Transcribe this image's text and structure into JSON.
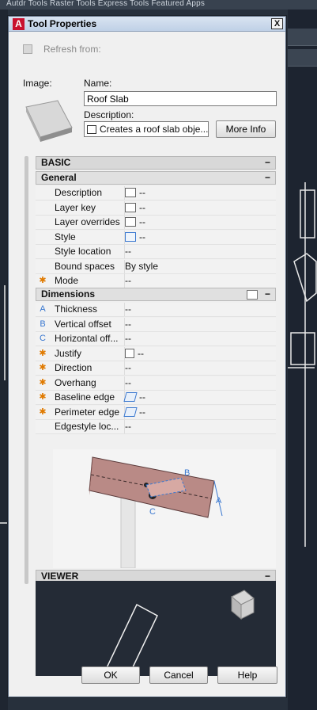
{
  "background": {
    "menu_text": "Autdr Tools    Raster Tools    Express Tools    Featured Apps"
  },
  "dialog": {
    "title": "Tool Properties",
    "close_label": "X",
    "refresh_label": "Refresh from:",
    "image_label": "Image:",
    "name_label": "Name:",
    "name_value": "Roof Slab",
    "description_label": "Description:",
    "description_value": "Creates a roof slab obje...",
    "more_info_label": "More Info"
  },
  "sections": {
    "basic": "BASIC",
    "general": "General",
    "dimensions": "Dimensions",
    "viewer": "VIEWER",
    "collapse_symbol": "−"
  },
  "general_rows": [
    {
      "key": "Description",
      "value": "--",
      "marker": "",
      "icon": "table-icon"
    },
    {
      "key": "Layer key",
      "value": "--",
      "marker": "",
      "icon": "table-icon"
    },
    {
      "key": "Layer overrides",
      "value": "--",
      "marker": "",
      "icon": "table-icon"
    },
    {
      "key": "Style",
      "value": "--",
      "marker": "",
      "icon": "style-icon"
    },
    {
      "key": "Style location",
      "value": "--",
      "marker": "",
      "icon": ""
    },
    {
      "key": "Bound spaces",
      "value": "By style",
      "marker": "",
      "icon": ""
    },
    {
      "key": "Mode",
      "value": "--",
      "marker": "✱",
      "icon": ""
    }
  ],
  "dimension_rows": [
    {
      "key": "Thickness",
      "value": "--",
      "marker": "A",
      "icon": ""
    },
    {
      "key": "Vertical offset",
      "value": "--",
      "marker": "B",
      "icon": ""
    },
    {
      "key": "Horizontal off...",
      "value": "--",
      "marker": "C",
      "icon": ""
    },
    {
      "key": "Justify",
      "value": "--",
      "marker": "✱",
      "icon": "checkbox-icon"
    },
    {
      "key": "Direction",
      "value": "--",
      "marker": "✱",
      "icon": ""
    },
    {
      "key": "Overhang",
      "value": "--",
      "marker": "✱",
      "icon": ""
    },
    {
      "key": "Baseline edge",
      "value": "--",
      "marker": "✱",
      "icon": "edge-icon"
    },
    {
      "key": "Perimeter edge",
      "value": "--",
      "marker": "✱",
      "icon": "edge-icon"
    },
    {
      "key": "Edgestyle loc...",
      "value": "--",
      "marker": "",
      "icon": ""
    }
  ],
  "diagram_labels": {
    "a": "A",
    "b": "B",
    "c": "C"
  },
  "buttons": {
    "ok": "OK",
    "cancel": "Cancel",
    "help": "Help"
  }
}
